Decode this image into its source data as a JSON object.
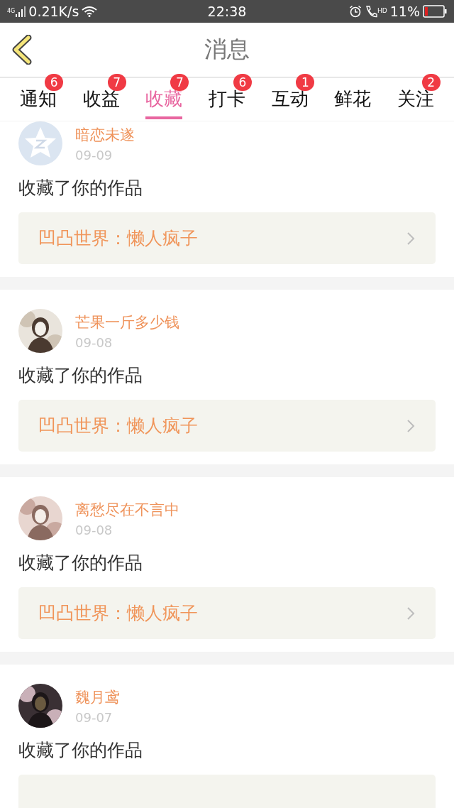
{
  "status_bar": {
    "network": "4G",
    "speed": "0.21K/s",
    "time": "22:38",
    "call_badge": "HD",
    "battery": "11%"
  },
  "header": {
    "title": "消息"
  },
  "tabs": [
    {
      "label": "通知",
      "badge": "6",
      "selected": false
    },
    {
      "label": "收益",
      "badge": "7",
      "selected": false
    },
    {
      "label": "收藏",
      "badge": "7",
      "selected": true
    },
    {
      "label": "打卡",
      "badge": "6",
      "selected": false
    },
    {
      "label": "互动",
      "badge": "1",
      "selected": false
    },
    {
      "label": "鲜花",
      "selected": false
    },
    {
      "label": "关注",
      "badge": "2",
      "selected": false
    }
  ],
  "messages": [
    {
      "avatar": {
        "kind": "default"
      },
      "name": "暗恋未遂",
      "date": "09-09",
      "action": "收藏了你的作品",
      "work": "凹凸世界：懒人疯子"
    },
    {
      "name": "芒果一斤多少钱",
      "date": "09-08",
      "action": "收藏了你的作品",
      "work": "凹凸世界：懒人疯子"
    },
    {
      "name": "离愁尽在不言中",
      "date": "09-08",
      "action": "收藏了你的作品",
      "work": "凹凸世界：懒人疯子"
    },
    {
      "name": "魏月鸢",
      "date": "09-07",
      "action": "收藏了你的作品"
    }
  ]
}
